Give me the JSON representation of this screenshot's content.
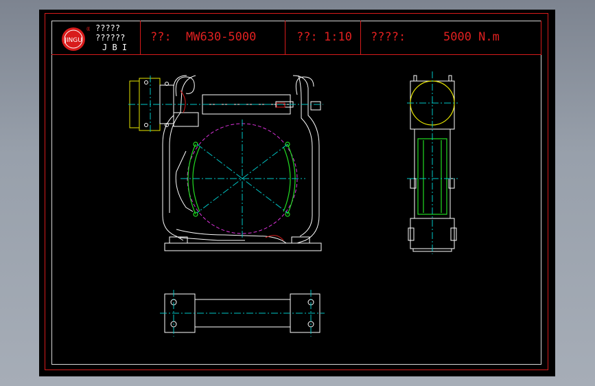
{
  "title_block": {
    "company_line1": "?????",
    "company_line2": "??????",
    "company_abbrev": "J B I",
    "logo_text": "JINGU",
    "logo_mark": "®",
    "model_label": "??:",
    "model_value": "MW630-5000",
    "scale_label": "??:",
    "scale_value": "1:10",
    "torque_label": "????:",
    "torque_value": "5000 N.m"
  },
  "colors": {
    "background": "#000000",
    "frame": "#d81b1b",
    "linework": "#ffffff",
    "centerline": "#00c8c8",
    "shoes": "#22dd22",
    "wheel": "#dd33dd",
    "motor": "#e8e800"
  }
}
